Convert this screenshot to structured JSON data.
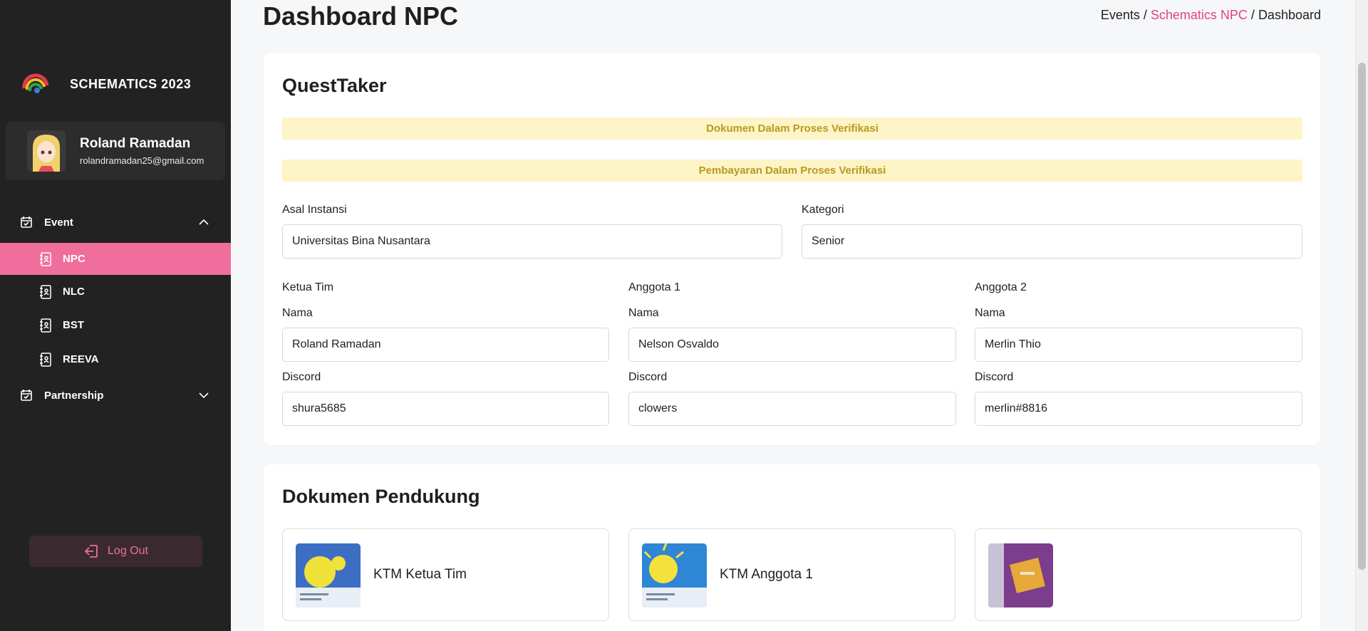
{
  "sidebar": {
    "brand": "SCHEMATICS 2023",
    "profile": {
      "name": "Roland Ramadan",
      "email": "rolandramadan25@gmail.com"
    },
    "groups": [
      {
        "label": "Event",
        "icon": "calendar-check-icon",
        "expanded": true
      },
      {
        "label": "Partnership",
        "icon": "calendar-check-icon",
        "expanded": false
      }
    ],
    "items": [
      {
        "label": "NPC",
        "icon": "contact-book-icon",
        "active": true
      },
      {
        "label": "NLC",
        "icon": "contact-book-icon",
        "active": false
      },
      {
        "label": "BST",
        "icon": "contact-book-icon",
        "active": false
      },
      {
        "label": "REEVA",
        "icon": "contact-book-icon",
        "active": false
      }
    ],
    "logout": "Log Out"
  },
  "header": {
    "title": "Dashboard NPC",
    "breadcrumb": {
      "first": "Events",
      "sep1": " / ",
      "link": "Schematics NPC",
      "sep2": " / ",
      "current": "Dashboard"
    }
  },
  "team": {
    "title": "QuestTaker",
    "alerts": [
      "Dokumen Dalam Proses Verifikasi",
      "Pembayaran Dalam Proses Verifikasi"
    ],
    "institution_label": "Asal Instansi",
    "institution_value": "Universitas Bina Nusantara",
    "category_label": "Kategori",
    "category_value": "Senior",
    "members": [
      {
        "role": "Ketua Tim",
        "name_label": "Nama",
        "name": "Roland Ramadan",
        "discord_label": "Discord",
        "discord": "shura5685"
      },
      {
        "role": "Anggota 1",
        "name_label": "Nama",
        "name": "Nelson Osvaldo",
        "discord_label": "Discord",
        "discord": "clowers"
      },
      {
        "role": "Anggota 2",
        "name_label": "Nama",
        "name": "Merlin Thio",
        "discord_label": "Discord",
        "discord": "merlin#8816"
      }
    ]
  },
  "documents": {
    "title": "Dokumen Pendukung",
    "items": [
      {
        "label": "KTM Ketua Tim"
      },
      {
        "label": "KTM Anggota 1"
      },
      {
        "label": ""
      }
    ]
  },
  "colors": {
    "sidebar_bg": "#222222",
    "accent": "#f06e9c",
    "alert_bg": "#fdf4c7",
    "alert_text": "#b89a1d"
  }
}
